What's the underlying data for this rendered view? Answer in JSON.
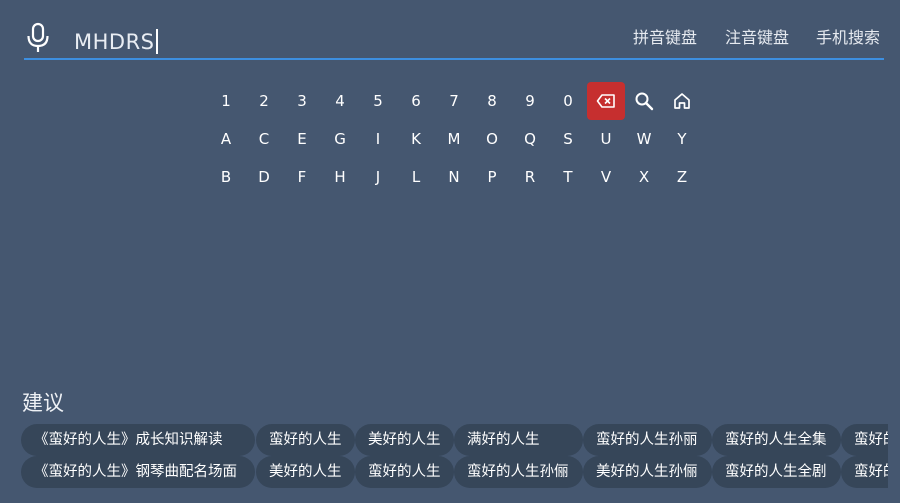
{
  "search": {
    "query": "MHDRS"
  },
  "modes": {
    "pinyin": "拼音键盘",
    "zhuyin": "注音键盘",
    "phone": "手机搜索"
  },
  "keyboard": {
    "row1": [
      "1",
      "2",
      "3",
      "4",
      "5",
      "6",
      "7",
      "8",
      "9",
      "0"
    ],
    "row2": [
      "A",
      "C",
      "E",
      "G",
      "I",
      "K",
      "M",
      "O",
      "Q",
      "S",
      "U",
      "W",
      "Y"
    ],
    "row3": [
      "B",
      "D",
      "F",
      "H",
      "J",
      "L",
      "N",
      "P",
      "R",
      "T",
      "V",
      "X",
      "Z"
    ],
    "special_keys": [
      "backspace-icon",
      "search-icon",
      "home-icon"
    ],
    "focused_key": "backspace",
    "focus_color": "#c62f2f"
  },
  "suggestions": {
    "title": "建议",
    "row1": [
      "《蛮好的人生》成长知识解读",
      "蛮好的人生",
      "美好的人生",
      "满好的人生",
      "蛮好的人生孙丽",
      "蛮好的人生全集",
      "蛮好的"
    ],
    "row2": [
      "《蛮好的人生》钢琴曲配名场面",
      "美好的人生",
      "蛮好的人生",
      "蛮好的人生孙俪",
      "美好的人生孙俪",
      "蛮好的人生全剧",
      "蛮好的"
    ]
  },
  "colors": {
    "background": "#455770",
    "underline": "#3d8fe0",
    "chip": "#364659"
  }
}
